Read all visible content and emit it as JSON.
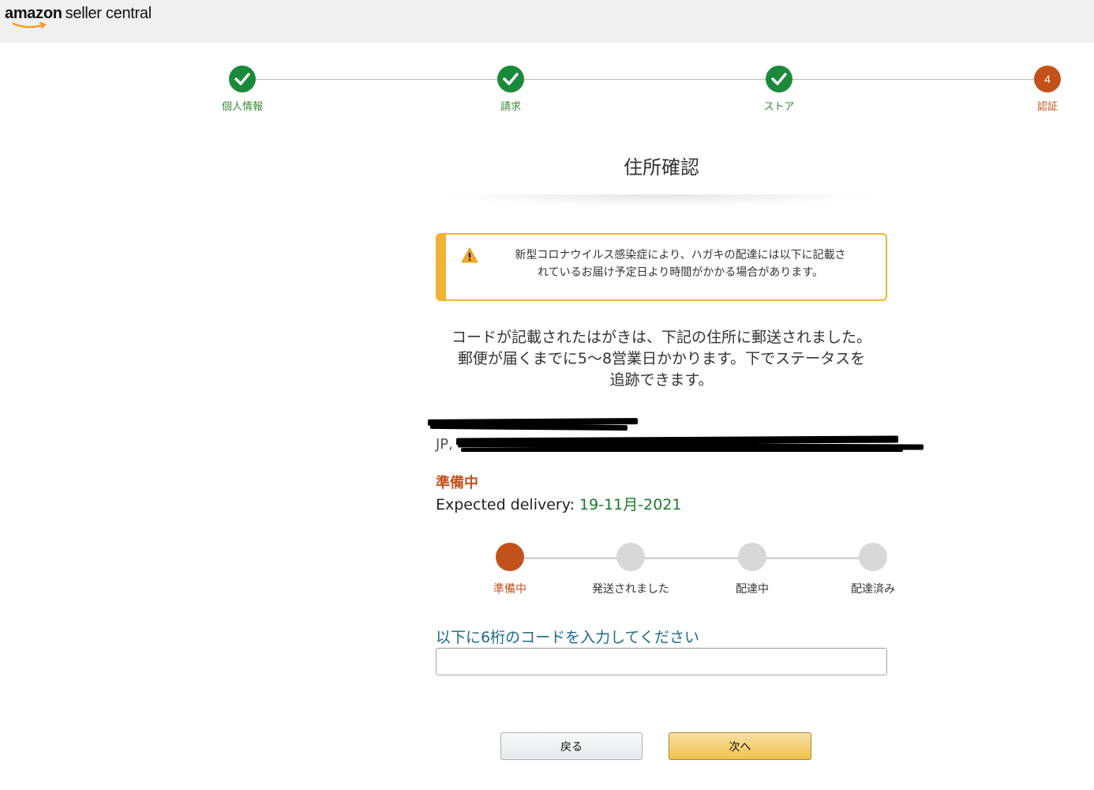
{
  "header": {
    "logo_amazon": "amazon",
    "logo_seller": "seller central"
  },
  "steps": [
    {
      "label": "個人情報",
      "state": "done"
    },
    {
      "label": "請求",
      "state": "done"
    },
    {
      "label": "ストア",
      "state": "done"
    },
    {
      "label": "認証",
      "state": "current",
      "number": "4"
    }
  ],
  "page_title": "住所確認",
  "alert": {
    "line1": "新型コロナウイルス感染症により、ハガキの配達には以下に記載さ",
    "line2": "れているお届け予定日より時間がかかる場合があります。"
  },
  "description": {
    "line1": "コードが記載されたはがきは、下記の住所に郵送されました。",
    "line2": "郵便が届くまでに5～8営業日かかります。下でステータスを",
    "line3": "追跡できます。"
  },
  "address": {
    "prefix": "JP,"
  },
  "status": "準備中",
  "delivery": {
    "label": "Expected delivery: ",
    "date": "19-11月-2021"
  },
  "tracker": {
    "current_index": 0,
    "steps": [
      "準備中",
      "発送されました",
      "配達中",
      "配達済み"
    ]
  },
  "code": {
    "label": "以下に6桁のコードを入力してください",
    "value": ""
  },
  "buttons": {
    "back": "戻る",
    "next": "次へ"
  },
  "colors": {
    "done": "#1a8a3a",
    "current": "#c2521a",
    "alert": "#f2b233",
    "link": "#1d6a88"
  }
}
